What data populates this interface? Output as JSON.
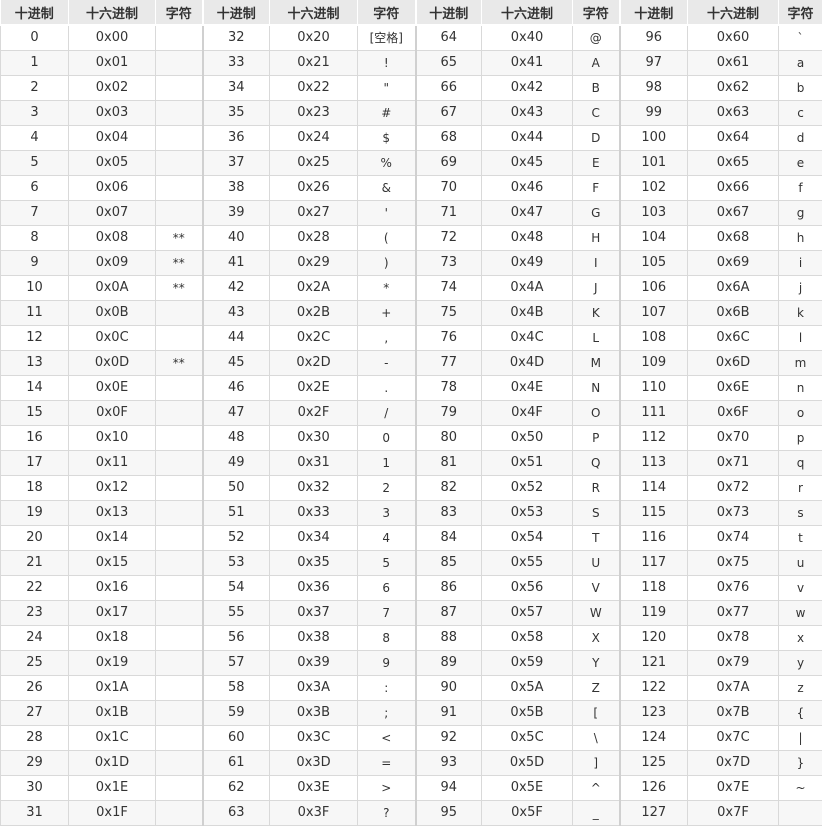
{
  "headers": {
    "dec": "十进制",
    "hex": "十六进制",
    "char": "字符"
  },
  "rows": [
    [
      [
        "0",
        "0x00",
        ""
      ],
      [
        "32",
        "0x20",
        "[空格]"
      ],
      [
        "64",
        "0x40",
        "@"
      ],
      [
        "96",
        "0x60",
        "`"
      ]
    ],
    [
      [
        "1",
        "0x01",
        ""
      ],
      [
        "33",
        "0x21",
        "!"
      ],
      [
        "65",
        "0x41",
        "A"
      ],
      [
        "97",
        "0x61",
        "a"
      ]
    ],
    [
      [
        "2",
        "0x02",
        ""
      ],
      [
        "34",
        "0x22",
        "\""
      ],
      [
        "66",
        "0x42",
        "B"
      ],
      [
        "98",
        "0x62",
        "b"
      ]
    ],
    [
      [
        "3",
        "0x03",
        ""
      ],
      [
        "35",
        "0x23",
        "#"
      ],
      [
        "67",
        "0x43",
        "C"
      ],
      [
        "99",
        "0x63",
        "c"
      ]
    ],
    [
      [
        "4",
        "0x04",
        ""
      ],
      [
        "36",
        "0x24",
        "$"
      ],
      [
        "68",
        "0x44",
        "D"
      ],
      [
        "100",
        "0x64",
        "d"
      ]
    ],
    [
      [
        "5",
        "0x05",
        ""
      ],
      [
        "37",
        "0x25",
        "%"
      ],
      [
        "69",
        "0x45",
        "E"
      ],
      [
        "101",
        "0x65",
        "e"
      ]
    ],
    [
      [
        "6",
        "0x06",
        ""
      ],
      [
        "38",
        "0x26",
        "&"
      ],
      [
        "70",
        "0x46",
        "F"
      ],
      [
        "102",
        "0x66",
        "f"
      ]
    ],
    [
      [
        "7",
        "0x07",
        ""
      ],
      [
        "39",
        "0x27",
        "'"
      ],
      [
        "71",
        "0x47",
        "G"
      ],
      [
        "103",
        "0x67",
        "g"
      ]
    ],
    [
      [
        "8",
        "0x08",
        "**"
      ],
      [
        "40",
        "0x28",
        "("
      ],
      [
        "72",
        "0x48",
        "H"
      ],
      [
        "104",
        "0x68",
        "h"
      ]
    ],
    [
      [
        "9",
        "0x09",
        "**"
      ],
      [
        "41",
        "0x29",
        ")"
      ],
      [
        "73",
        "0x49",
        "I"
      ],
      [
        "105",
        "0x69",
        "i"
      ]
    ],
    [
      [
        "10",
        "0x0A",
        "**"
      ],
      [
        "42",
        "0x2A",
        "*"
      ],
      [
        "74",
        "0x4A",
        "J"
      ],
      [
        "106",
        "0x6A",
        "j"
      ]
    ],
    [
      [
        "11",
        "0x0B",
        ""
      ],
      [
        "43",
        "0x2B",
        "+"
      ],
      [
        "75",
        "0x4B",
        "K"
      ],
      [
        "107",
        "0x6B",
        "k"
      ]
    ],
    [
      [
        "12",
        "0x0C",
        ""
      ],
      [
        "44",
        "0x2C",
        ","
      ],
      [
        "76",
        "0x4C",
        "L"
      ],
      [
        "108",
        "0x6C",
        "l"
      ]
    ],
    [
      [
        "13",
        "0x0D",
        "**"
      ],
      [
        "45",
        "0x2D",
        "-"
      ],
      [
        "77",
        "0x4D",
        "M"
      ],
      [
        "109",
        "0x6D",
        "m"
      ]
    ],
    [
      [
        "14",
        "0x0E",
        ""
      ],
      [
        "46",
        "0x2E",
        "."
      ],
      [
        "78",
        "0x4E",
        "N"
      ],
      [
        "110",
        "0x6E",
        "n"
      ]
    ],
    [
      [
        "15",
        "0x0F",
        ""
      ],
      [
        "47",
        "0x2F",
        "/"
      ],
      [
        "79",
        "0x4F",
        "O"
      ],
      [
        "111",
        "0x6F",
        "o"
      ]
    ],
    [
      [
        "16",
        "0x10",
        ""
      ],
      [
        "48",
        "0x30",
        "0"
      ],
      [
        "80",
        "0x50",
        "P"
      ],
      [
        "112",
        "0x70",
        "p"
      ]
    ],
    [
      [
        "17",
        "0x11",
        ""
      ],
      [
        "49",
        "0x31",
        "1"
      ],
      [
        "81",
        "0x51",
        "Q"
      ],
      [
        "113",
        "0x71",
        "q"
      ]
    ],
    [
      [
        "18",
        "0x12",
        ""
      ],
      [
        "50",
        "0x32",
        "2"
      ],
      [
        "82",
        "0x52",
        "R"
      ],
      [
        "114",
        "0x72",
        "r"
      ]
    ],
    [
      [
        "19",
        "0x13",
        ""
      ],
      [
        "51",
        "0x33",
        "3"
      ],
      [
        "83",
        "0x53",
        "S"
      ],
      [
        "115",
        "0x73",
        "s"
      ]
    ],
    [
      [
        "20",
        "0x14",
        ""
      ],
      [
        "52",
        "0x34",
        "4"
      ],
      [
        "84",
        "0x54",
        "T"
      ],
      [
        "116",
        "0x74",
        "t"
      ]
    ],
    [
      [
        "21",
        "0x15",
        ""
      ],
      [
        "53",
        "0x35",
        "5"
      ],
      [
        "85",
        "0x55",
        "U"
      ],
      [
        "117",
        "0x75",
        "u"
      ]
    ],
    [
      [
        "22",
        "0x16",
        ""
      ],
      [
        "54",
        "0x36",
        "6"
      ],
      [
        "86",
        "0x56",
        "V"
      ],
      [
        "118",
        "0x76",
        "v"
      ]
    ],
    [
      [
        "23",
        "0x17",
        ""
      ],
      [
        "55",
        "0x37",
        "7"
      ],
      [
        "87",
        "0x57",
        "W"
      ],
      [
        "119",
        "0x77",
        "w"
      ]
    ],
    [
      [
        "24",
        "0x18",
        ""
      ],
      [
        "56",
        "0x38",
        "8"
      ],
      [
        "88",
        "0x58",
        "X"
      ],
      [
        "120",
        "0x78",
        "x"
      ]
    ],
    [
      [
        "25",
        "0x19",
        ""
      ],
      [
        "57",
        "0x39",
        "9"
      ],
      [
        "89",
        "0x59",
        "Y"
      ],
      [
        "121",
        "0x79",
        "y"
      ]
    ],
    [
      [
        "26",
        "0x1A",
        ""
      ],
      [
        "58",
        "0x3A",
        ":"
      ],
      [
        "90",
        "0x5A",
        "Z"
      ],
      [
        "122",
        "0x7A",
        "z"
      ]
    ],
    [
      [
        "27",
        "0x1B",
        ""
      ],
      [
        "59",
        "0x3B",
        ";"
      ],
      [
        "91",
        "0x5B",
        "["
      ],
      [
        "123",
        "0x7B",
        "{"
      ]
    ],
    [
      [
        "28",
        "0x1C",
        ""
      ],
      [
        "60",
        "0x3C",
        "<"
      ],
      [
        "92",
        "0x5C",
        "\\"
      ],
      [
        "124",
        "0x7C",
        "|"
      ]
    ],
    [
      [
        "29",
        "0x1D",
        ""
      ],
      [
        "61",
        "0x3D",
        "="
      ],
      [
        "93",
        "0x5D",
        "]"
      ],
      [
        "125",
        "0x7D",
        "}"
      ]
    ],
    [
      [
        "30",
        "0x1E",
        ""
      ],
      [
        "62",
        "0x3E",
        ">"
      ],
      [
        "94",
        "0x5E",
        "^"
      ],
      [
        "126",
        "0x7E",
        "~"
      ]
    ],
    [
      [
        "31",
        "0x1F",
        ""
      ],
      [
        "63",
        "0x3F",
        "?"
      ],
      [
        "95",
        "0x5F",
        "_"
      ],
      [
        "127",
        "0x7F",
        ""
      ]
    ]
  ]
}
